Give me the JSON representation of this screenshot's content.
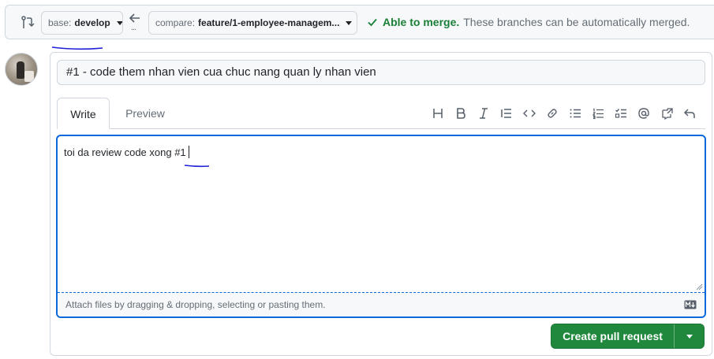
{
  "compare_bar": {
    "base_prefix": "base:",
    "base_branch": "develop",
    "compare_prefix": "compare:",
    "compare_branch": "feature/1-employee-managem...",
    "ellipsis": "...",
    "merge_status": "Able to merge.",
    "merge_message": "These branches can be automatically merged."
  },
  "pull_request": {
    "title": "#1 - code them nhan vien cua chuc nang quan ly nhan vien",
    "tabs": [
      {
        "label": "Write"
      },
      {
        "label": "Preview"
      }
    ],
    "toolbar_icons": [
      "heading-icon",
      "bold-icon",
      "italic-icon",
      "quote-icon",
      "code-icon",
      "link-icon",
      "unordered-list-icon",
      "ordered-list-icon",
      "task-list-icon",
      "mention-icon",
      "cross-reference-icon",
      "undo-icon"
    ],
    "body_text": "toi da review code xong #1",
    "attach_hint": "Attach files by dragging & dropping, selecting or pasting them."
  },
  "actions": {
    "create_label": "Create pull request"
  },
  "colors": {
    "success": "#1a7f37",
    "primary_button": "#1f883d",
    "focus": "#0969da",
    "annotation_ink": "#1f1fd6"
  }
}
